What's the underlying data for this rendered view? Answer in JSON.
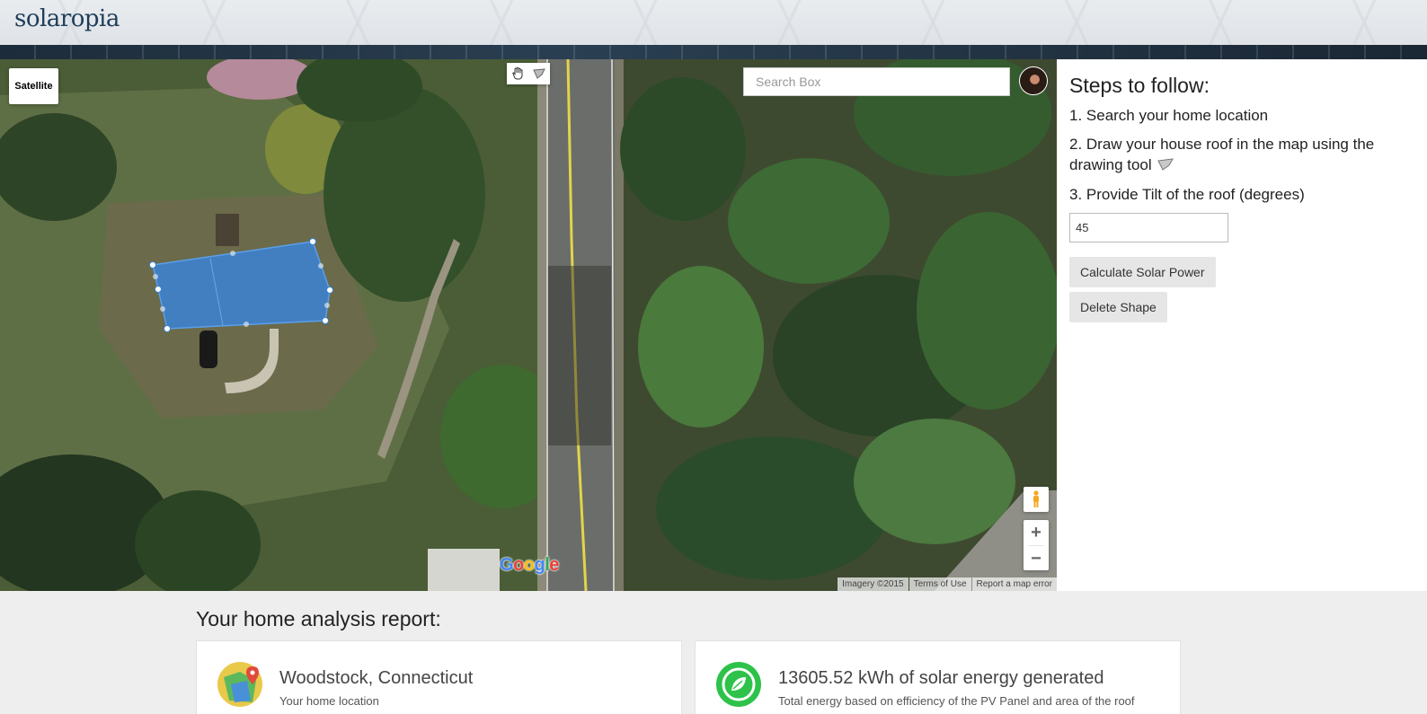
{
  "header": {
    "logo": "solaropia"
  },
  "map": {
    "type_button": "Satellite",
    "search_placeholder": "Search Box",
    "zoom_in": "+",
    "zoom_out": "−",
    "google": "Google",
    "attribution": [
      "Imagery ©2015",
      "Terms of Use",
      "Report a map error"
    ]
  },
  "panel": {
    "title": "Steps to follow:",
    "step1": "1. Search your home location",
    "step2": "2. Draw your house roof in the map using the drawing tool",
    "step3": "3. Provide Tilt of the roof (degrees)",
    "tilt_value": "45",
    "calculate_button": "Calculate Solar Power",
    "delete_button": "Delete Shape"
  },
  "report": {
    "title": "Your home analysis report:",
    "location": {
      "value": "Woodstock, Connecticut",
      "label": "Your home location"
    },
    "energy": {
      "value": "13605.52",
      "unit": "kWh of solar energy generated",
      "label": "Total energy based on efficiency of the PV Panel and area of the roof"
    }
  },
  "colors": {
    "roof_fill": "#3b82d6",
    "logo": "#1f3d5a",
    "energy_icon": "#2ec24a"
  }
}
